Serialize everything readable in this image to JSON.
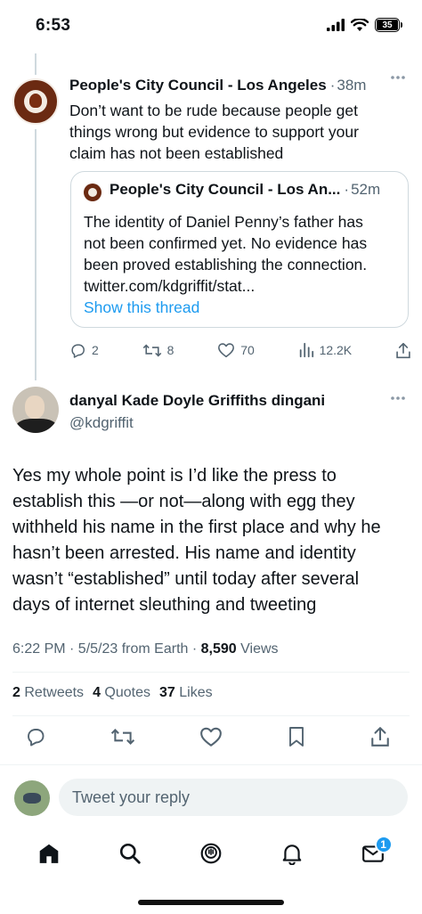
{
  "status_bar": {
    "time": "6:53",
    "battery": "35"
  },
  "parent_tweet": {
    "name": "People's City Council - Los Angeles",
    "time": "38m",
    "text_lines": [
      "Don’t want to be rude because people get",
      "things wrong but evidence to support your",
      "claim has not been established"
    ],
    "quoted": {
      "name": "People's City Council - Los An...",
      "time": "52m",
      "text_lines": [
        "The identity of Daniel Penny’s father has",
        "not been confirmed yet. No evidence has",
        "been proved establishing the connection.",
        "twitter.com/kdgriffit/stat..."
      ],
      "show_thread": "Show this thread"
    },
    "actions": {
      "replies": "2",
      "retweets": "8",
      "likes": "70",
      "views": "12.2K"
    }
  },
  "main_tweet": {
    "name": "danyal Kade Doyle Griffiths dingani",
    "handle": "@kdgriffit",
    "text_lines": [
      "Yes my whole point is I’d like the press to",
      "establish this —or not—along with egg they",
      "withheld his name in the first place and why he",
      "hasn’t been arrested. His name and identity",
      "wasn’t “established” until today after several",
      "days of internet sleuthing and tweeting"
    ],
    "timestamp": "6:22 PM · 5/5/23 from Earth · ",
    "views_count": "8,590",
    "views_label": " Views",
    "stats": {
      "retweets_count": "2",
      "retweets_label": "Retweets",
      "quotes_count": "4",
      "quotes_label": "Quotes",
      "likes_count": "37",
      "likes_label": "Likes"
    }
  },
  "reply": {
    "placeholder": "Tweet your reply"
  },
  "tab_bar": {
    "messages_badge": "1"
  },
  "icons": {
    "reply": "reply-icon",
    "retweet": "retweet-icon",
    "like": "heart-icon",
    "views": "views-icon",
    "share": "share-icon",
    "bookmark": "bookmark-icon",
    "home": "home-icon",
    "search": "search-icon",
    "spaces": "spaces-icon",
    "notifications": "bell-icon",
    "messages": "mail-icon"
  },
  "colors": {
    "accent": "#1d9bf0",
    "text": "#0f1419",
    "muted": "#536471",
    "border": "#cfd9de"
  }
}
